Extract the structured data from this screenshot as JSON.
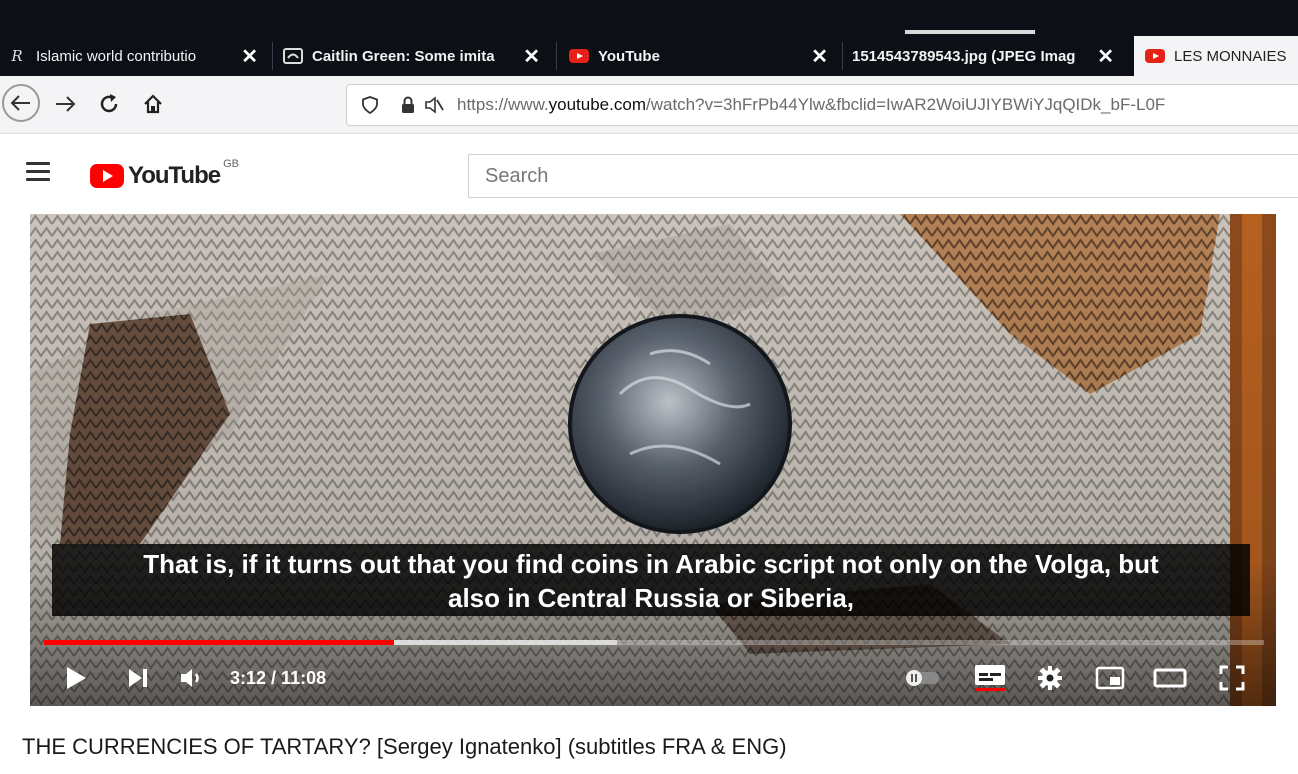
{
  "browser": {
    "tabs": [
      {
        "label": "Islamic world contributio",
        "favicon": "r-icon",
        "active": false
      },
      {
        "label": "Caitlin Green: Some imita",
        "favicon": "blogger-icon",
        "active": false
      },
      {
        "label": "YouTube",
        "favicon": "youtube-icon",
        "active": false
      },
      {
        "label": "1514543789543.jpg (JPEG Imag",
        "favicon": "none",
        "active": false
      },
      {
        "label": "LES MONNAIES",
        "favicon": "youtube-icon",
        "active": true
      }
    ],
    "close_glyph": "✕",
    "url": {
      "scheme": "https://www.",
      "domain": "youtube.com",
      "rest": "/watch?v=3hFrPb44Ylw&fbclid=IwAR2WoiUJIYBWiYJqQIDk_bF-L0F"
    }
  },
  "youtube": {
    "logo_word": "YouTube",
    "region": "GB",
    "search_placeholder": "Search"
  },
  "player": {
    "caption_line1": "That is, if it turns out that you find coins in Arabic script not only on the Volga, but",
    "caption_line2": "also in Central Russia or Siberia,",
    "current_time": "3:12",
    "duration": "11:08",
    "played_fraction": 0.287,
    "buffered_fraction": 0.47
  },
  "video": {
    "title": "THE CURRENCIES OF TARTARY? [Sergey Ignatenko] (subtitles FRA & ENG)"
  },
  "colors": {
    "tabbar": "#0d0f16",
    "youtube_red": "#ff0000",
    "progress_played": "#ff0000"
  }
}
